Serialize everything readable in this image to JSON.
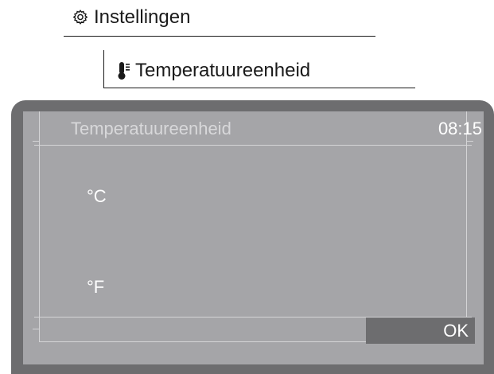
{
  "breadcrumb": {
    "level1": {
      "icon": "gear-icon",
      "label": "Instellingen"
    },
    "level2": {
      "icon": "thermometer-icon",
      "label": "Temperatuureenheid"
    }
  },
  "screen": {
    "title": "Temperatuureenheid",
    "time": "08:15",
    "options": [
      {
        "label": "°C"
      },
      {
        "label": "°F"
      }
    ],
    "ok_label": "OK"
  },
  "colors": {
    "frame": "#6d6d6f",
    "screen_background": "#a5a5a8",
    "text_light": "#ffffff",
    "title_text": "#d8d8da"
  }
}
